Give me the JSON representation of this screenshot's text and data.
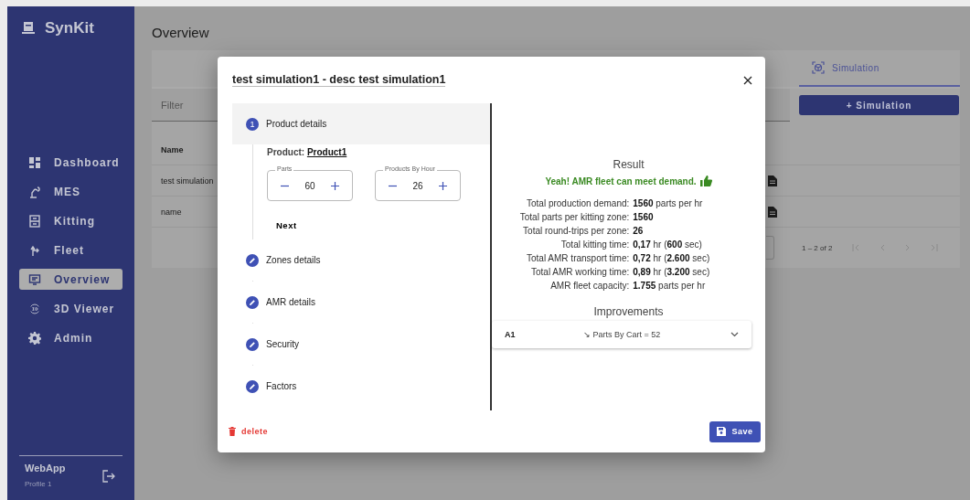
{
  "app": {
    "name": "SynKit"
  },
  "sidebar": {
    "items": [
      {
        "label": "Dashboard",
        "selected": false
      },
      {
        "label": "MES",
        "selected": false
      },
      {
        "label": "Kitting",
        "selected": false
      },
      {
        "label": "Fleet",
        "selected": false
      },
      {
        "label": "Overview",
        "selected": true
      },
      {
        "label": "3D Viewer",
        "selected": false
      },
      {
        "label": "Admin",
        "selected": false
      }
    ],
    "user": {
      "name": "WebApp",
      "profile": "Profile 1"
    }
  },
  "page": {
    "title": "Overview",
    "tabs": [
      {
        "label": "Simulation",
        "selected": true
      }
    ],
    "filter": {
      "placeholder": "Filter"
    },
    "add_button": "+ Simulation",
    "table": {
      "columns": [
        "Name"
      ],
      "rows": [
        {
          "name": "test simulation"
        },
        {
          "name": "name"
        }
      ]
    },
    "pagination": {
      "range": "1 – 2 of 2"
    }
  },
  "dialog": {
    "title": "test simulation1 - desc test simulation1",
    "steps": [
      {
        "label": "Product details",
        "kind": "number",
        "number": "1",
        "selected": true
      },
      {
        "label": "Zones details",
        "kind": "edit",
        "selected": false
      },
      {
        "label": "AMR details",
        "kind": "edit",
        "selected": false
      },
      {
        "label": "Security",
        "kind": "edit",
        "selected": false
      },
      {
        "label": "Factors",
        "kind": "edit",
        "selected": false
      }
    ],
    "product": {
      "label": "Product:",
      "value": "Product1"
    },
    "fields": [
      {
        "label": "Parts",
        "value": "60"
      },
      {
        "label": "Products By Hour",
        "value": "26"
      }
    ],
    "next_button": "Next",
    "result": {
      "title": "Result",
      "message": "Yeah! AMR fleet can meet demand.",
      "stats": [
        {
          "label": "Total production demand:",
          "value": "**1560** parts per hr"
        },
        {
          "label": "Total parts per kitting zone:",
          "value": "**1560**"
        },
        {
          "label": "Total round-trips per zone:",
          "value": "**26**"
        },
        {
          "label": "Total kitting time:",
          "value": "**0,17** hr (**600** sec)"
        },
        {
          "label": "Total AMR transport time:",
          "value": "**0,72** hr (**2.600** sec)"
        },
        {
          "label": "Total AMR working time:",
          "value": "**0,89** hr (**3.200** sec)"
        },
        {
          "label": "AMR fleet capacity:",
          "value": "**1.755** parts per hr"
        }
      ]
    },
    "improvements": {
      "title": "Improvements",
      "items": [
        {
          "code": "A1",
          "change": "↘ Parts By Cart = 52",
          "expanded": false
        }
      ]
    },
    "delete_button": "delete",
    "save_button": "Save"
  }
}
